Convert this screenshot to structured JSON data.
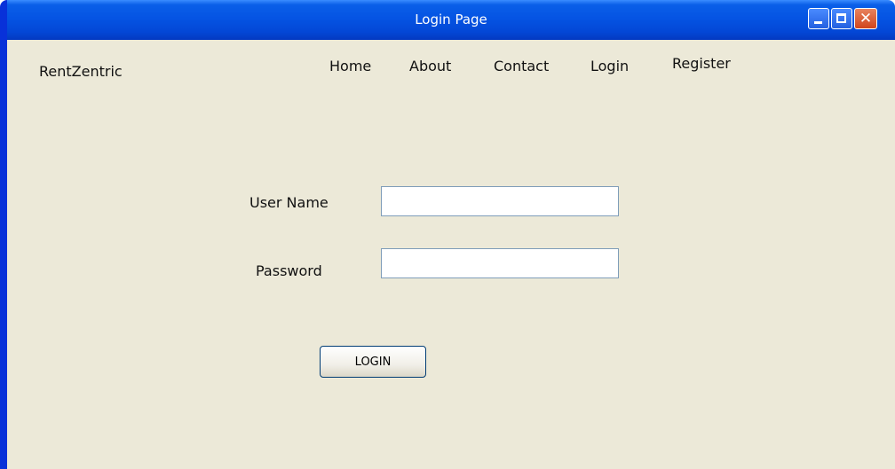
{
  "window": {
    "title": "Login Page",
    "controls": {
      "minimize_icon": "minimize-icon",
      "maximize_icon": "maximize-icon",
      "close_icon": "close-icon",
      "close_glyph": "✕"
    },
    "colors": {
      "titlebar": "#0554e3",
      "frame": "#0831d9",
      "background": "#ece9d8",
      "close_button": "#d0451c"
    }
  },
  "header": {
    "brand": "RentZentric",
    "nav": [
      "Home",
      "About",
      "Contact",
      "Login",
      "Register"
    ]
  },
  "form": {
    "username_label": "User Name",
    "password_label": "Password",
    "username_value": "",
    "password_value": "",
    "submit_label": "LOGIN"
  }
}
